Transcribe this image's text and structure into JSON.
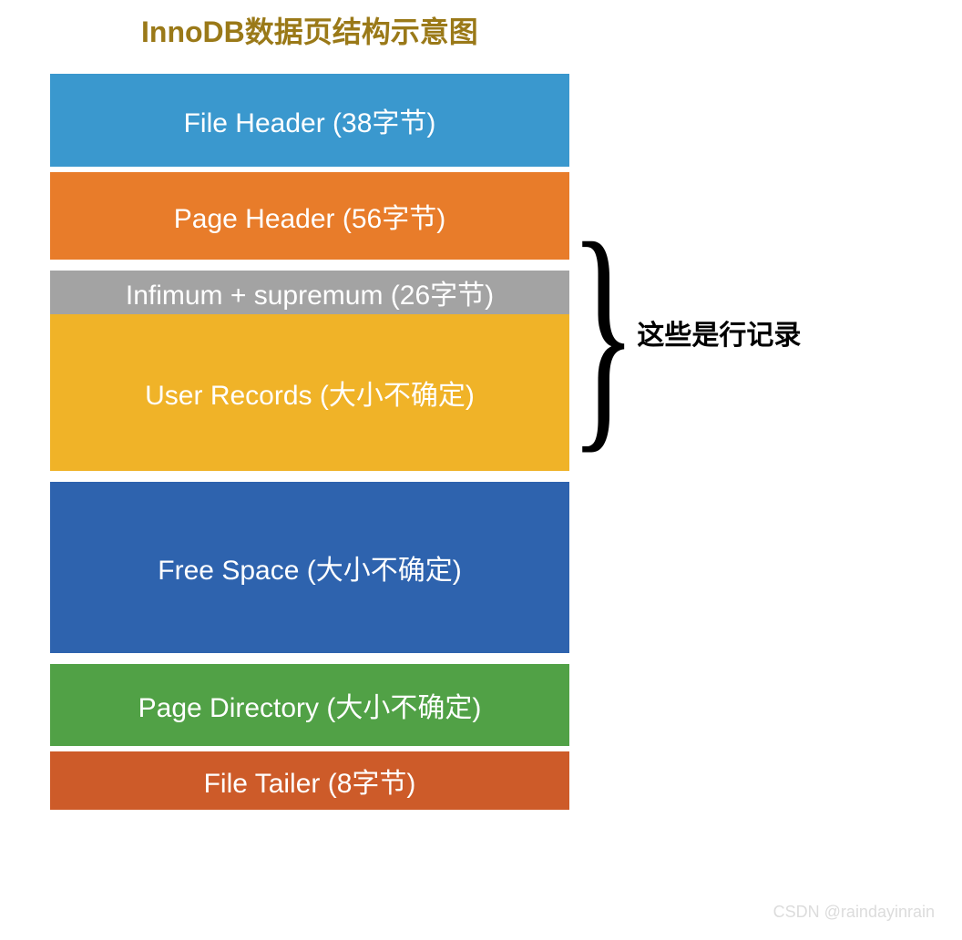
{
  "title": "InnoDB数据页结构示意图",
  "blocks": {
    "file_header": "File Header (38字节)",
    "page_header": "Page Header (56字节)",
    "infimum": "Infimum + supremum (26字节)",
    "user_records": "User Records (大小不确定)",
    "free_space": "Free Space (大小不确定)",
    "page_directory": "Page Directory (大小不确定)",
    "file_tailer": "File Tailer (8字节)"
  },
  "annotation": "这些是行记录",
  "watermark": "CSDN @raindayinrain"
}
